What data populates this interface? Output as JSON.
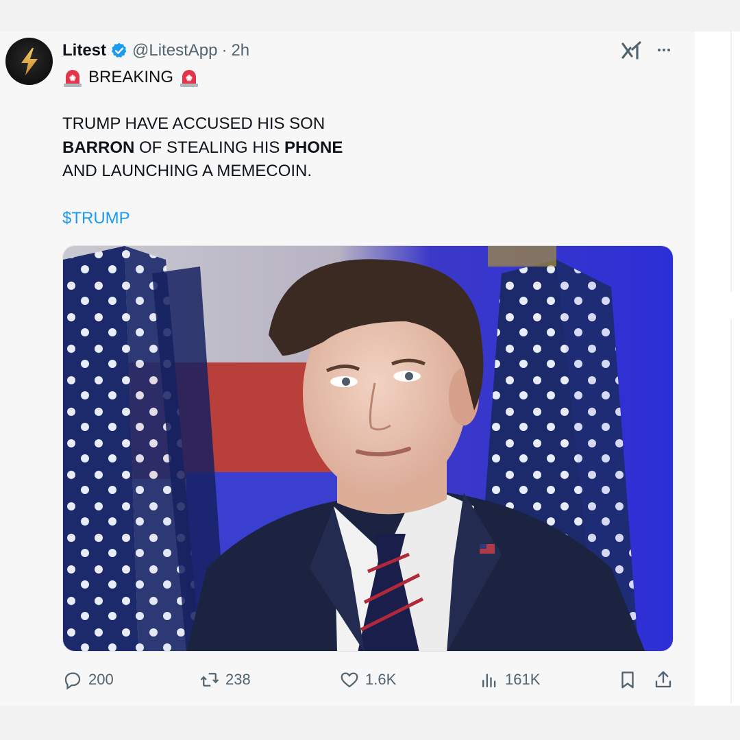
{
  "tweet": {
    "display_name": "Litest",
    "handle": "@LitestApp",
    "separator": "·",
    "time": "2h",
    "breaking_label": "BREAKING",
    "line1": "TRUMP HAVE ACCUSED HIS SON",
    "line2_bold_a": "BARRON",
    "line2_mid": " OF STEALING HIS ",
    "line2_bold_b": "PHONE",
    "line3": "AND LAUNCHING A MEMECOIN.",
    "cashtag": "$TRUMP",
    "icons": {
      "avatar": "lightning-bolt-logo",
      "verified": "verified-badge-icon",
      "grok": "grok-icon",
      "more": "more-icon",
      "siren": "police-siren-emoji"
    }
  },
  "actions": {
    "reply_count": "200",
    "repost_count": "238",
    "like_count": "1.6K",
    "views_count": "161K",
    "icons": [
      "reply-icon",
      "repost-icon",
      "like-icon",
      "views-icon",
      "bookmark-icon",
      "share-icon"
    ]
  },
  "colors": {
    "accent": "#1d9bf0",
    "secondary_text": "#536471",
    "primary_text": "#0f1419",
    "card_bg": "#f7f7f7"
  }
}
